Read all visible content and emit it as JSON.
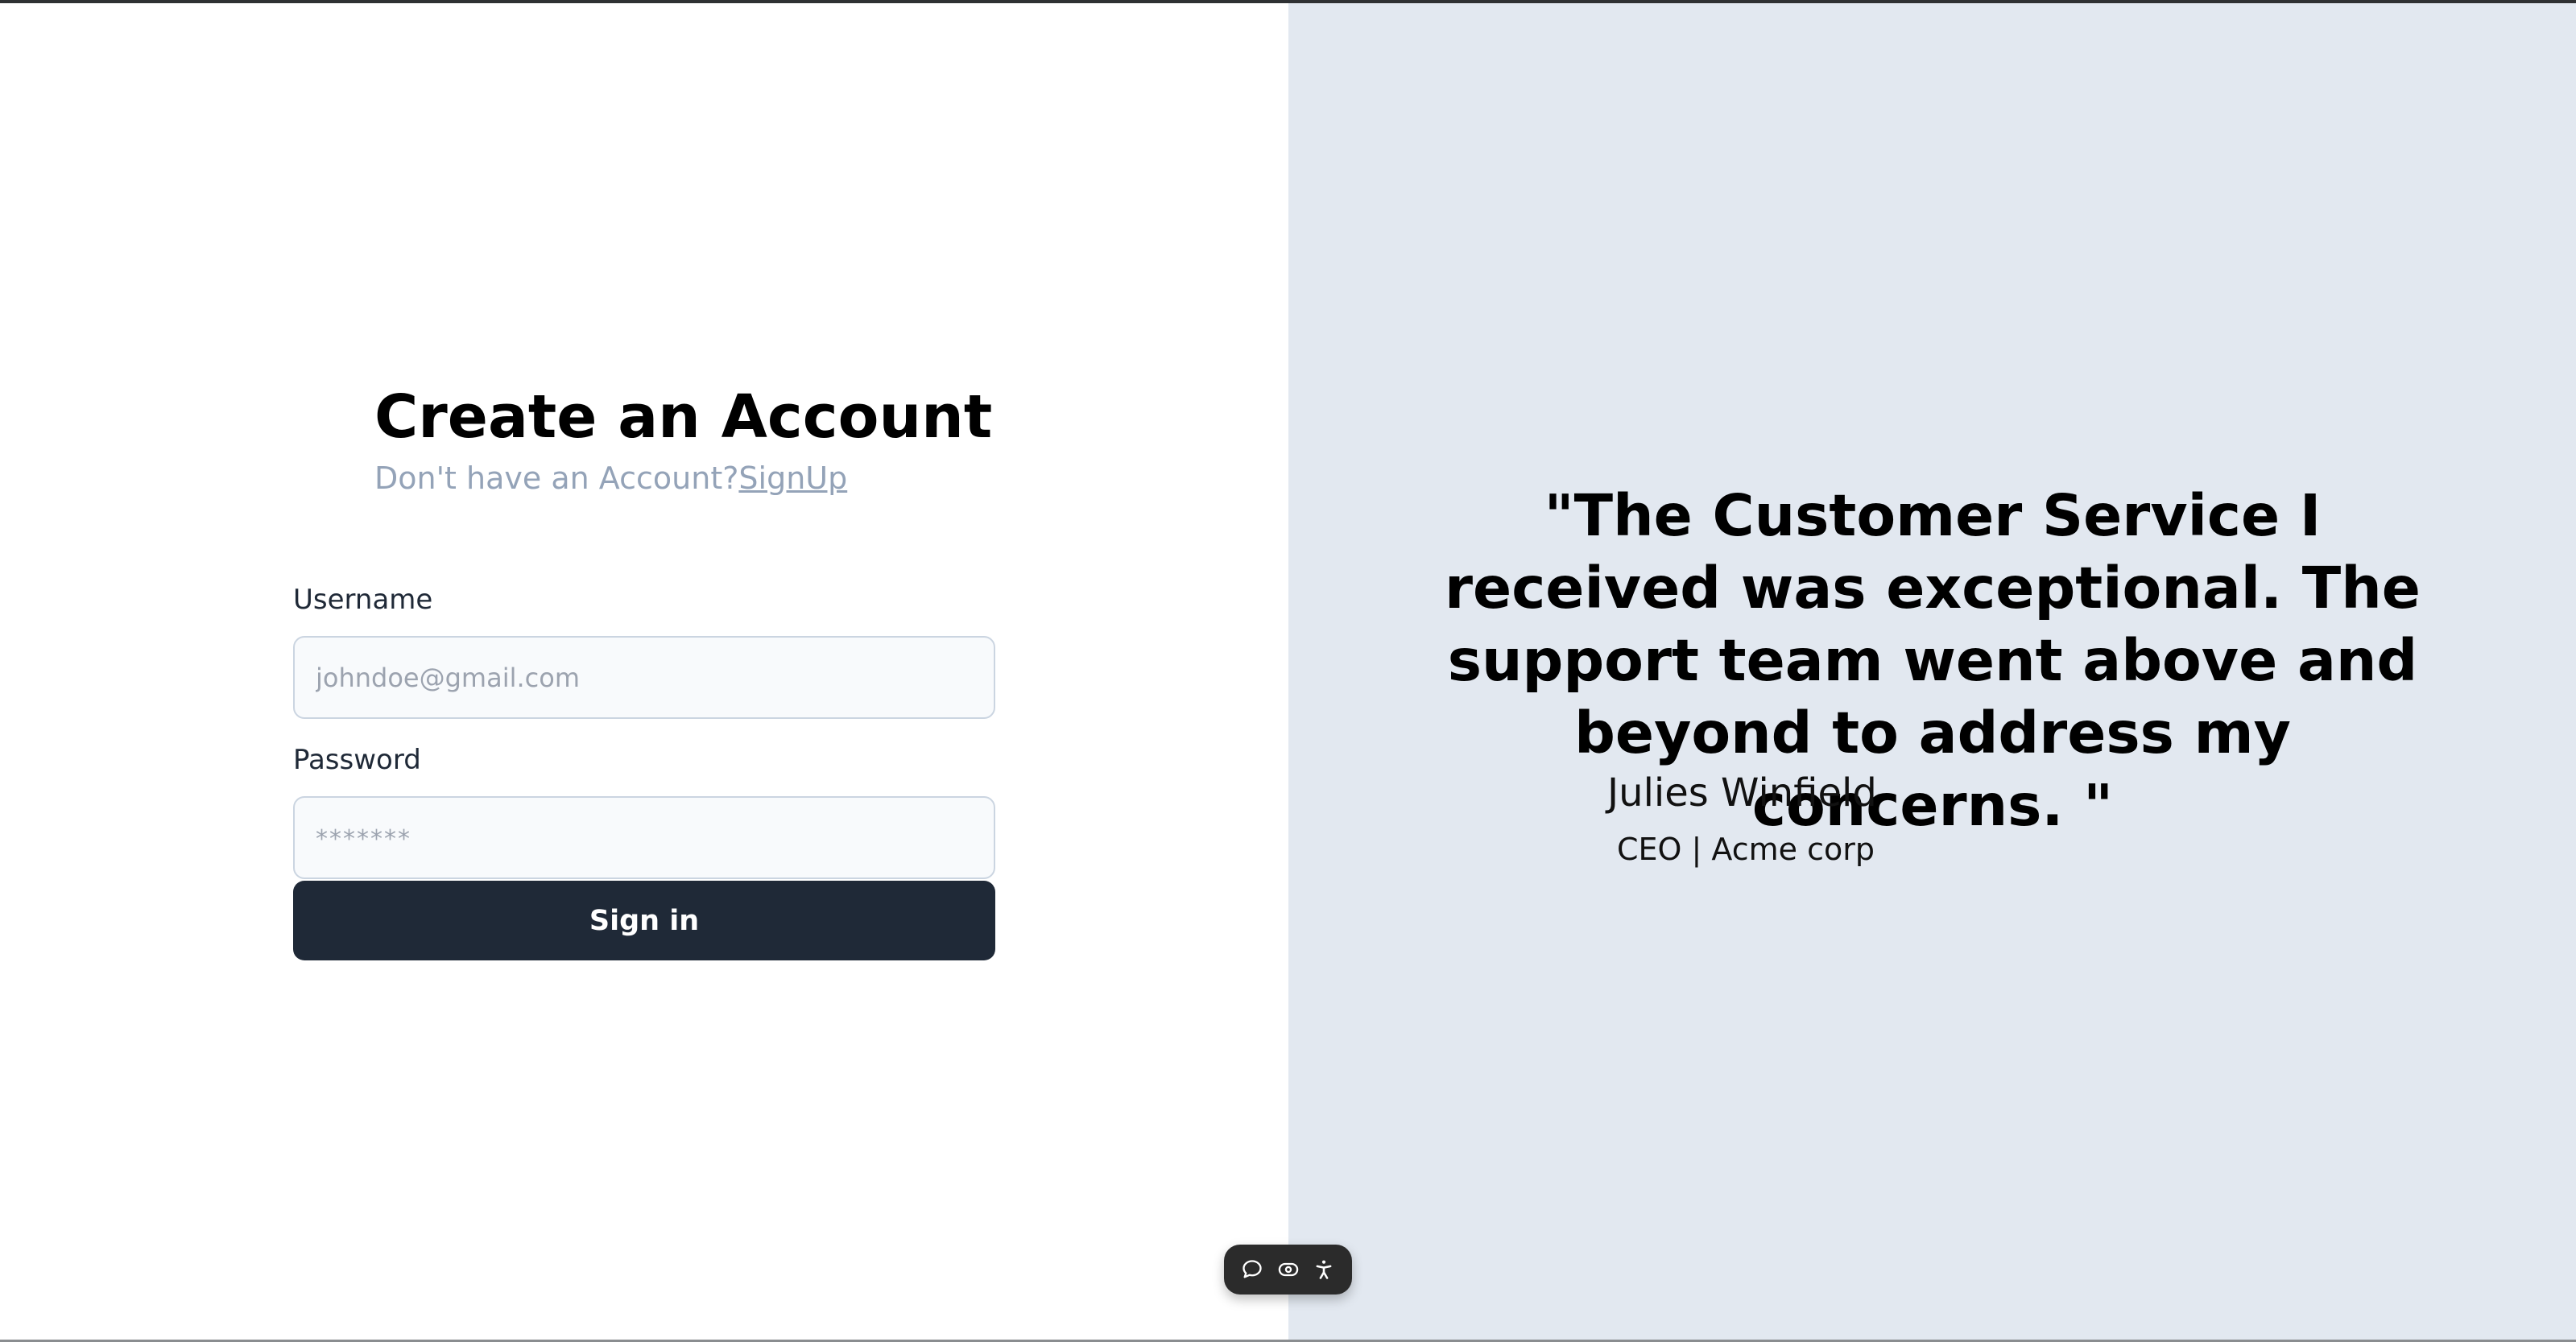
{
  "auth": {
    "title": "Create an Account",
    "prompt_text": "Don't have an Account?",
    "signup_link": "SignUp",
    "username_label": "Username",
    "username_placeholder": "johndoe@gmail.com",
    "password_label": "Password",
    "password_placeholder": "*******",
    "signin_label": "Sign in"
  },
  "testimonial": {
    "quote": "\"The Customer Service I received was exceptional. The support team went above and beyond to address my concerns. \"",
    "author_name": "Julies Winfield",
    "author_role": "CEO | Acme corp"
  },
  "widget": {
    "icons": [
      "chat-bubble-icon",
      "eye-icon",
      "accessibility-icon"
    ]
  },
  "colors": {
    "right_panel_bg": "#e2e8f0",
    "button_bg": "#1f2937",
    "muted_text": "#94a3b8",
    "input_bg": "#f8fafc"
  }
}
